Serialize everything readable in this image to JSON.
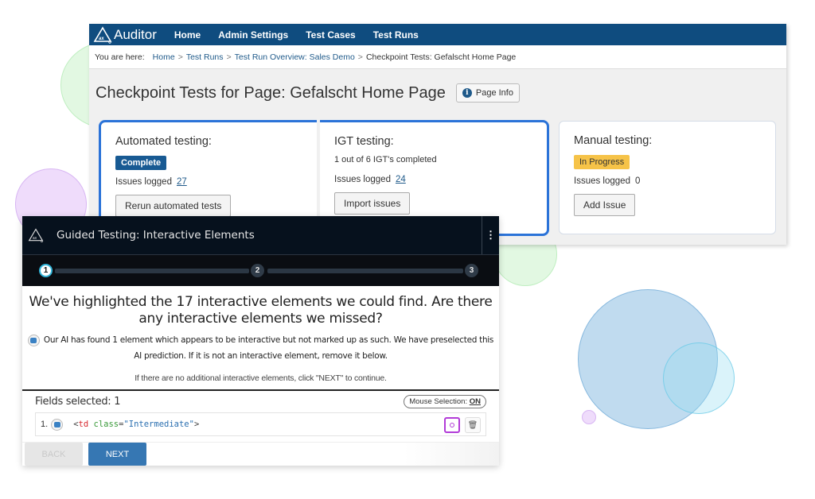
{
  "auditor": {
    "logo_text": "Auditor",
    "nav": [
      "Home",
      "Admin Settings",
      "Test Cases",
      "Test Runs"
    ],
    "breadcrumb": {
      "label": "You are here:",
      "items": [
        "Home",
        "Test Runs",
        "Test Run Overview: Sales Demo"
      ],
      "current": "Checkpoint Tests: Gefalscht Home Page",
      "separator": ">"
    },
    "page_title": "Checkpoint Tests for Page: Gefalscht Home Page",
    "page_info_label": "Page Info",
    "cards": {
      "automated": {
        "title": "Automated testing:",
        "status": "Complete",
        "issues_label": "Issues logged",
        "issues_count": "27",
        "button": "Rerun automated tests"
      },
      "igt": {
        "title": "IGT testing:",
        "progress": "1 out of 6 IGT's completed",
        "issues_label": "Issues logged",
        "issues_count": "24",
        "button": "Import issues"
      },
      "manual": {
        "title": "Manual testing:",
        "status": "In Progress",
        "issues_label": "Issues logged",
        "issues_count": "0",
        "button": "Add Issue"
      }
    }
  },
  "guided": {
    "title": "Guided Testing: Interactive Elements",
    "menu_glyph": "⋮",
    "steps": [
      "1",
      "2",
      "3"
    ],
    "current_step": 1,
    "heading": "We've highlighted the 17 interactive elements we could find. Are there any interactive elements we missed?",
    "ai_note": "Our AI has found 1 element which appears to be interactive but not marked up as such. We have preselected this AI prediction. If it is not an interactive element, remove it below.",
    "hint": "If there are no additional interactive elements, click \"NEXT\" to continue.",
    "fields_selected_label": "Fields selected: 1",
    "mouse_selection_label": "Mouse Selection:",
    "mouse_selection_value": "ON",
    "fields": [
      {
        "num": "1.",
        "code": {
          "open": "<",
          "tag": "td",
          "attr": "class",
          "eq": "=",
          "value": "\"Intermediate\"",
          "close": ">"
        }
      }
    ],
    "back_label": "BACK",
    "next_label": "NEXT",
    "trash_glyph": "🗑"
  },
  "colors": {
    "nav_bg": "#0f4c7f",
    "complete_badge": "#185a93",
    "progress_badge": "#f6c348",
    "highlight_border": "#2b73d8",
    "guided_header": "#06111d",
    "locate_accent": "#b23cd8",
    "next_button": "#3677b3"
  }
}
